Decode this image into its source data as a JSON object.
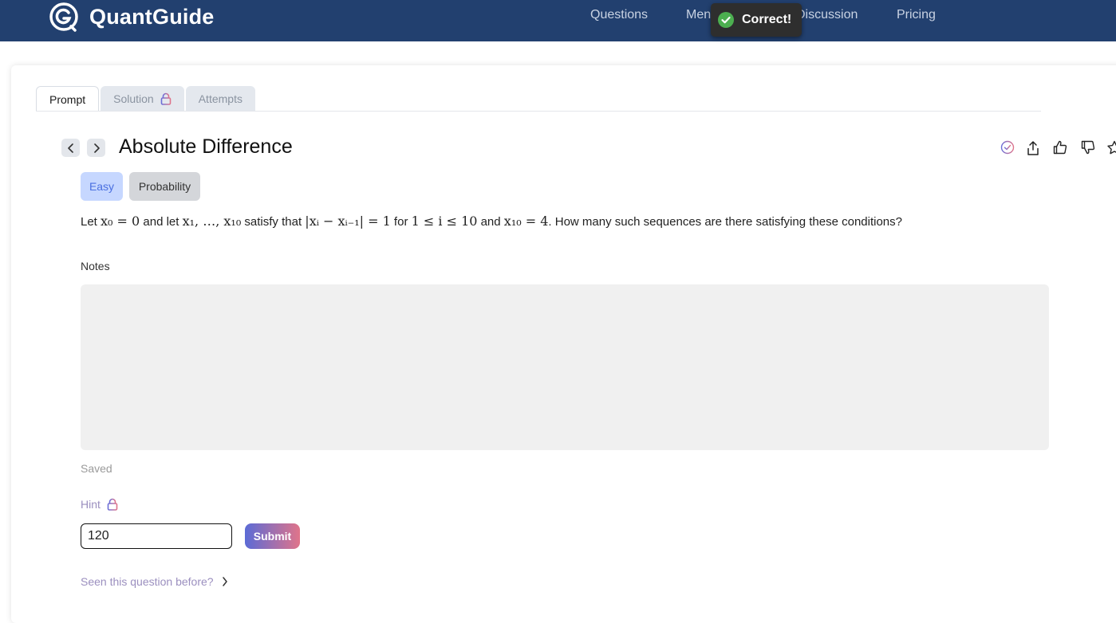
{
  "brand": {
    "name": "QuantGuide"
  },
  "nav": {
    "items": [
      {
        "label": "Questions"
      },
      {
        "label": "Men"
      },
      {
        "label": "Discussion"
      },
      {
        "label": "Pricing"
      }
    ]
  },
  "toast": {
    "text": "Correct!",
    "color": "#4caf50"
  },
  "tabs": [
    {
      "label": "Prompt",
      "active": true
    },
    {
      "label": "Solution",
      "locked": true
    },
    {
      "label": "Attempts"
    }
  ],
  "question": {
    "title": "Absolute Difference",
    "difficulty": "Easy",
    "topic": "Probability",
    "prompt_parts": [
      "Let ",
      "x₀ = 0",
      " and let ",
      "x₁, …, x₁₀",
      " satisfy that ",
      "|xᵢ − xᵢ₋₁| = 1",
      " for ",
      "1 ≤ i ≤ 10",
      " and ",
      "x₁₀ = 4",
      ". How many such sequences are there satisfying these conditions?"
    ]
  },
  "notes": {
    "label": "Notes",
    "status": "Saved"
  },
  "hint": {
    "label": "Hint"
  },
  "answer": {
    "value": "120",
    "submit_label": "Submit"
  },
  "footer": {
    "seen_label": "Seen this question before?"
  },
  "colors": {
    "nav_bg": "#22406f",
    "accent": "#5b6bd6",
    "hint_purple": "#9b8fbf"
  }
}
